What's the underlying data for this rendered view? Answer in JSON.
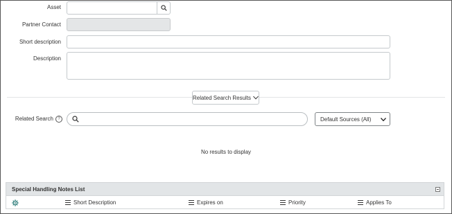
{
  "form": {
    "asset_label": "Asset",
    "asset_value": "",
    "partner_contact_label": "Partner Contact",
    "partner_contact_value": "",
    "short_description_label": "Short description",
    "short_description_value": "",
    "description_label": "Description",
    "description_value": ""
  },
  "related_search": {
    "toggle_label": "Related Search Results",
    "label": "Related Search",
    "help_icon": "help-circle-icon",
    "search_icon": "search-icon",
    "query": "",
    "sources_selected": "Default Sources (All)",
    "no_results_text": "No results to display"
  },
  "notes_list": {
    "title": "Special Handling Notes List",
    "settings_icon": "gear-icon",
    "columns": [
      "Short Description",
      "Expires on",
      "Priority",
      "Applies To"
    ]
  },
  "colors": {
    "header_bg": "#e2e5e7",
    "gear_accent": "#2e7d7a",
    "field_border": "#c4c9cc",
    "readonly_bg": "#e4e6e7"
  }
}
